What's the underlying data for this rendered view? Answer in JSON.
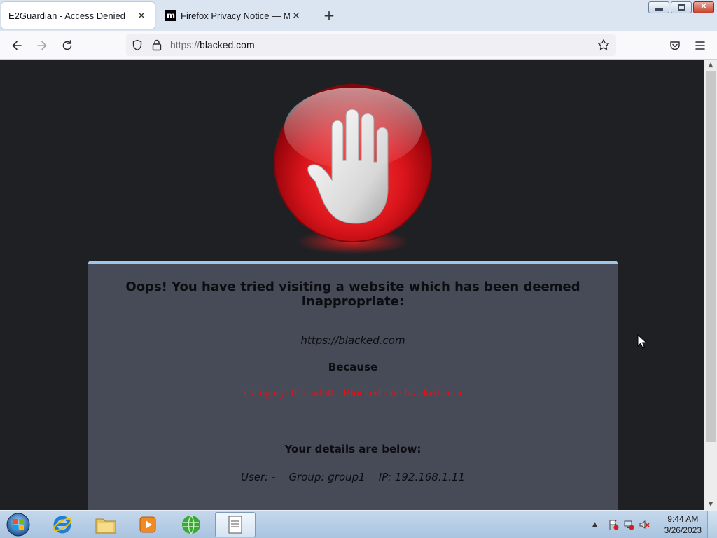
{
  "browser": {
    "tabs": [
      {
        "title": "E2Guardian - Access Denied",
        "active": true
      },
      {
        "title": "Firefox Privacy Notice — Mozilla",
        "active": false,
        "favicon": "m"
      }
    ],
    "url_scheme": "https://",
    "url_host": "blacked.com"
  },
  "page": {
    "headline": "Oops! You have tried visiting a website which has been deemed inappropriate:",
    "blocked_url": "https://blacked.com",
    "because_label": "Because",
    "reason": "Category: 011-adult - Blocked site: blacked.com",
    "details_heading": "Your details are below:",
    "details_line": "User: -    Group: group1    IP: 192.168.1.11"
  },
  "taskbar": {
    "clock_time": "9:44 AM",
    "clock_date": "3/26/2023"
  },
  "colors": {
    "page_background": "#1f2024",
    "panel_background": "#474b57",
    "panel_top_border": "#9fc7ee",
    "reason_text": "#e0121a",
    "stop_sign_red": "#d9141b"
  },
  "icons": {
    "stop": "stop-hand-icon",
    "back": "back-arrow-icon",
    "forward": "forward-arrow-icon",
    "reload": "reload-icon",
    "shield": "tracking-shield-icon",
    "lock": "lock-icon",
    "bookmark": "star-icon",
    "pocket": "pocket-icon",
    "menu": "hamburger-menu-icon"
  }
}
